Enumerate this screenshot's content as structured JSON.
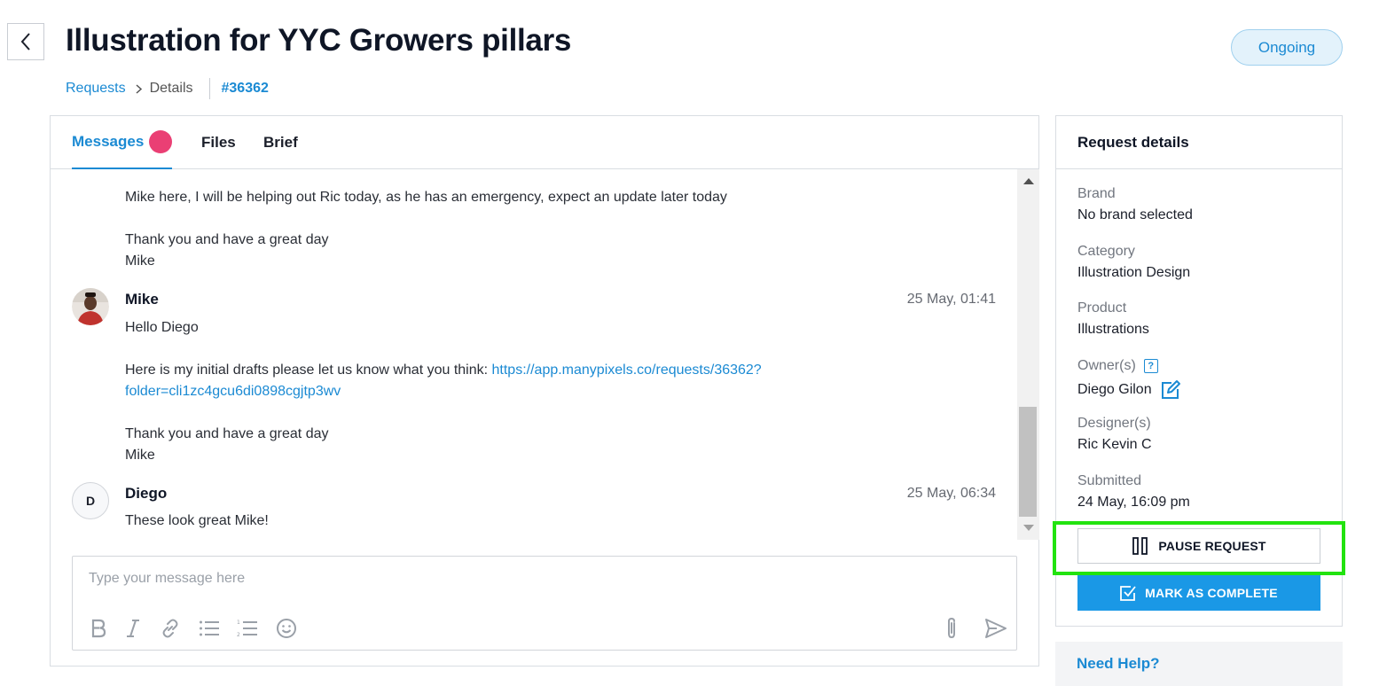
{
  "header": {
    "title": "Illustration for YYC Growers pillars",
    "status": "Ongoing"
  },
  "breadcrumb": {
    "parent": "Requests",
    "current": "Details",
    "id": "#36362"
  },
  "tabs": [
    {
      "label": "Messages",
      "active": true,
      "has_badge": true
    },
    {
      "label": "Files",
      "active": false
    },
    {
      "label": "Brief",
      "active": false
    }
  ],
  "messages": {
    "partial": {
      "line1": "Mike here, I will be helping out Ric today, as he has an emergency, expect an update later today",
      "line2": "Thank you and have a great day",
      "line3": "Mike"
    },
    "items": [
      {
        "author": "Mike",
        "time": "25 May, 01:41",
        "greeting": "Hello Diego",
        "text_before_link": "Here is my initial drafts please let us know what you think: ",
        "link_line1": "https://app.manypixels.co/requests/36362?",
        "link_line2": "folder=cli1zc4gcu6di0898cgjtp3wv",
        "closing1": "Thank you and have a great day",
        "closing2": "Mike"
      },
      {
        "author": "Diego",
        "avatar_letter": "D",
        "time": "25 May, 06:34",
        "text": "These look great Mike!"
      }
    ]
  },
  "composer": {
    "placeholder": "Type your message here",
    "tools": [
      "bold-icon",
      "italic-icon",
      "link-icon",
      "bullet-list-icon",
      "numbered-list-icon",
      "emoji-icon",
      "attach-icon",
      "send-icon"
    ]
  },
  "details": {
    "title": "Request details",
    "brand_label": "Brand",
    "brand_value": "No brand selected",
    "category_label": "Category",
    "category_value": "Illustration Design",
    "product_label": "Product",
    "product_value": "Illustrations",
    "owner_label": "Owner(s)",
    "owner_value": "Diego Gilon",
    "designer_label": "Designer(s)",
    "designer_value": "Ric Kevin C",
    "submitted_label": "Submitted",
    "submitted_value": "24 May, 16:09 pm"
  },
  "actions": {
    "pause_label": "PAUSE REQUEST",
    "complete_label": "MARK AS COMPLETE"
  },
  "help": {
    "title": "Need Help?"
  },
  "colors": {
    "accent": "#1b8ad3",
    "primary_button": "#1a98e6",
    "badge": "#ea3f74",
    "highlight": "#22e30f"
  }
}
